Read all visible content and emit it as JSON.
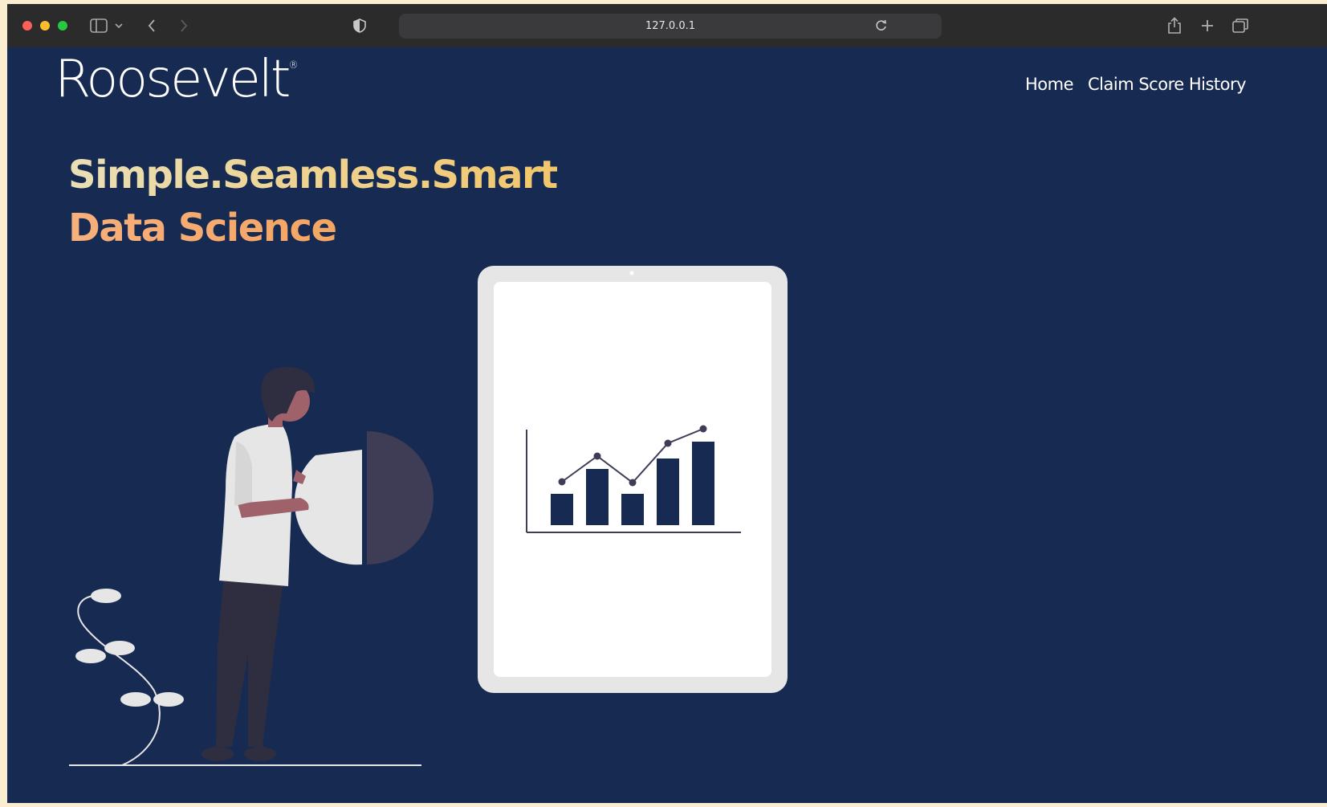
{
  "browser": {
    "url": "127.0.0.1",
    "icons": [
      "sidebar-icon",
      "chevron-down-icon",
      "back-icon",
      "forward-icon",
      "privacy-shield-icon",
      "reload-icon",
      "share-icon",
      "new-tab-icon",
      "tabs-overview-icon"
    ]
  },
  "site": {
    "logo": "Roosevelt",
    "logo_mark": "®",
    "nav": {
      "home": "Home",
      "claim_history": "Claim Score History"
    },
    "headline": {
      "line1": "Simple.Seamless.Smart",
      "line2": "Data Science"
    },
    "colors": {
      "background": "#172a52",
      "headline_line1": "#f2c66b",
      "headline_line2": "#f29c4c",
      "tablet_frame": "#e6e6e6",
      "chart_bars": "#172a52"
    }
  }
}
